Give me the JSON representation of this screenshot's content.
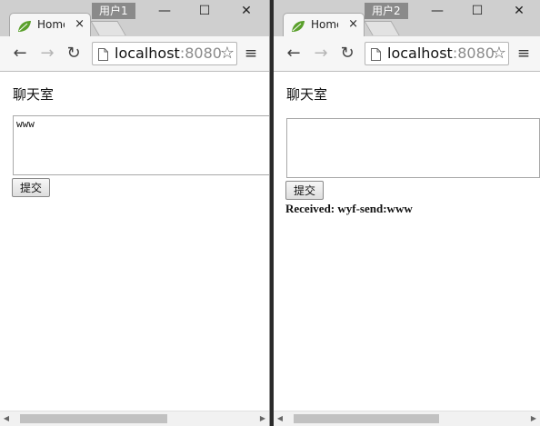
{
  "windows": [
    {
      "user_label": "用户1",
      "tab": {
        "title": "Home",
        "close": "×"
      },
      "url": {
        "host": "localhost",
        "port": ":8080"
      },
      "page_title": "聊天室",
      "textarea_value": "www",
      "submit_label": "提交",
      "received": ""
    },
    {
      "user_label": "用户2",
      "tab": {
        "title": "Home",
        "close": "×"
      },
      "url": {
        "host": "localhost",
        "port": ":8080"
      },
      "page_title": "聊天室",
      "textarea_value": "",
      "submit_label": "提交",
      "received": "Received: wyf-send:www"
    }
  ],
  "controls": {
    "minimize": "—",
    "maximize": "☐",
    "close": "✕"
  },
  "nav": {
    "back": "←",
    "forward": "→",
    "reload": "↻",
    "menu": "≡",
    "star": "☆"
  },
  "scroll": {
    "left": "◀",
    "right": "▶"
  },
  "colors": {
    "leaf": "#5aa02c",
    "chrome_frame": "#cfcfcf",
    "toolbar": "#f6f6f6"
  }
}
